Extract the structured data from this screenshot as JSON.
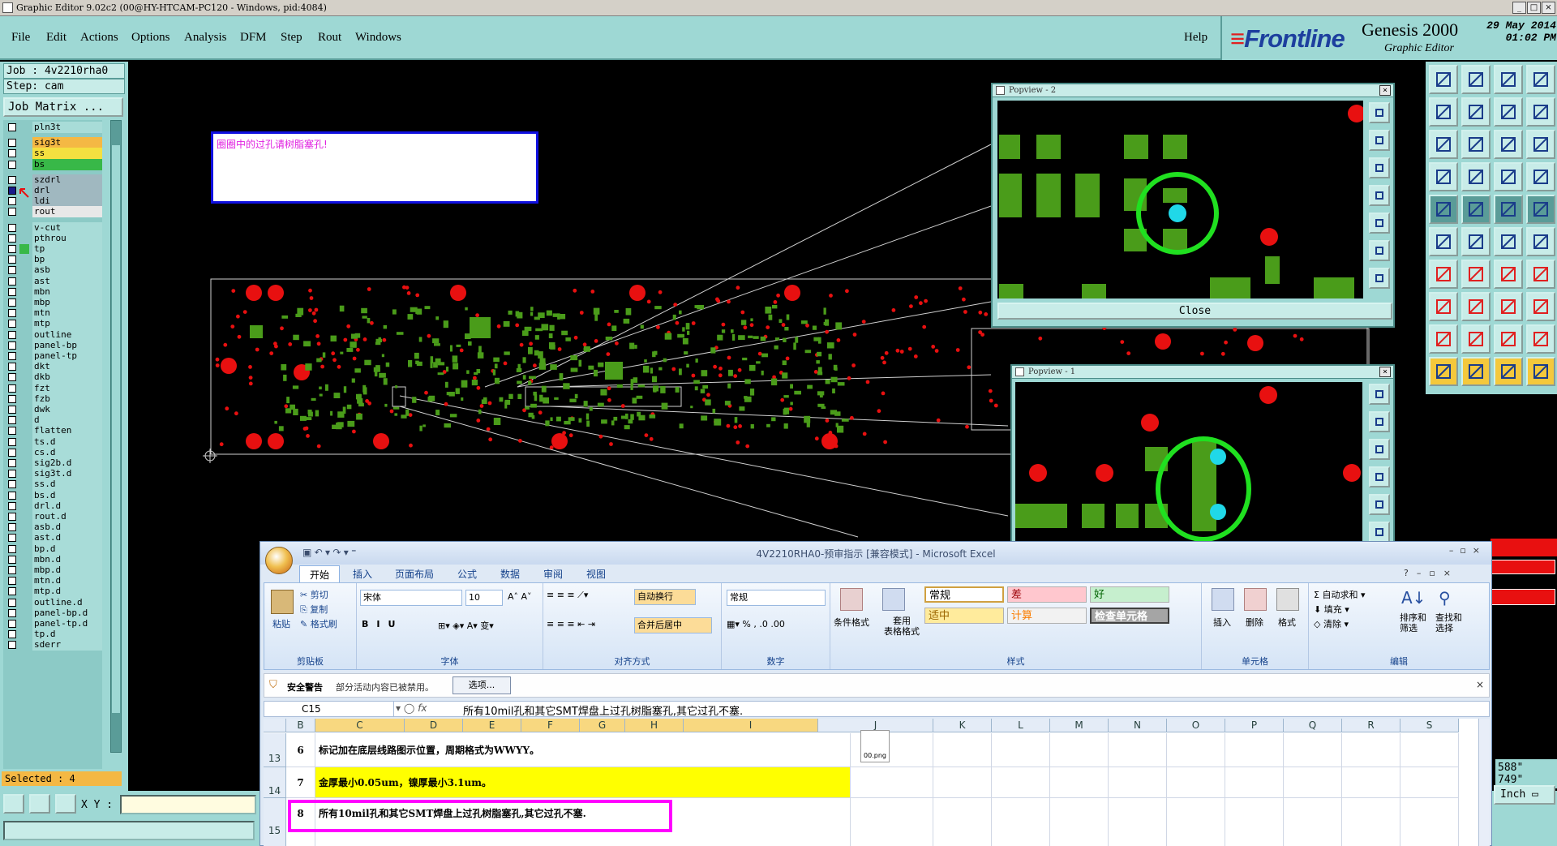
{
  "window": {
    "title": "Graphic Editor 9.02c2 (00@HY-HTCAM-PC120 - Windows, pid:4084)"
  },
  "menu": {
    "items": [
      "File",
      "Edit",
      "Actions",
      "Options",
      "Analysis",
      "DFM",
      "Step",
      "Rout",
      "Windows"
    ],
    "help": "Help"
  },
  "brand": {
    "logo": "Frontline",
    "product": "Genesis 2000",
    "subtitle": "Graphic Editor",
    "date": "29 May 2014",
    "time": "01:02 PM"
  },
  "job": {
    "job_label": "Job : 4v2210rha0",
    "step_label": "Step: cam",
    "matrix_button": "Job Matrix ..."
  },
  "layers": [
    {
      "name": "pln3t",
      "color": "default",
      "group": 0
    },
    {
      "name": "sig3t",
      "color": "orange",
      "group": 1
    },
    {
      "name": "ss",
      "color": "yellow",
      "group": 1
    },
    {
      "name": "bs",
      "color": "green",
      "group": 1
    },
    {
      "name": "szdrl",
      "color": "grey",
      "group": 2
    },
    {
      "name": "drl",
      "color": "grey",
      "group": 2,
      "active": true
    },
    {
      "name": "ldi",
      "color": "grey",
      "group": 2
    },
    {
      "name": "rout",
      "color": "white",
      "group": 2
    },
    {
      "name": "v-cut",
      "color": "default",
      "group": 3
    },
    {
      "name": "pthrou",
      "color": "default",
      "group": 3
    },
    {
      "name": "tp",
      "color": "default",
      "group": 3,
      "marked": true
    },
    {
      "name": "bp",
      "color": "default",
      "group": 3
    },
    {
      "name": "asb",
      "color": "default",
      "group": 3
    },
    {
      "name": "ast",
      "color": "default",
      "group": 3
    },
    {
      "name": "mbn",
      "color": "default",
      "group": 3
    },
    {
      "name": "mbp",
      "color": "default",
      "group": 3
    },
    {
      "name": "mtn",
      "color": "default",
      "group": 3
    },
    {
      "name": "mtp",
      "color": "default",
      "group": 3
    },
    {
      "name": "outline",
      "color": "default",
      "group": 3
    },
    {
      "name": "panel-bp",
      "color": "default",
      "group": 3
    },
    {
      "name": "panel-tp",
      "color": "default",
      "group": 3
    },
    {
      "name": "dkt",
      "color": "default",
      "group": 3
    },
    {
      "name": "dkb",
      "color": "default",
      "group": 3
    },
    {
      "name": "fzt",
      "color": "default",
      "group": 3
    },
    {
      "name": "fzb",
      "color": "default",
      "group": 3
    },
    {
      "name": "dwk",
      "color": "default",
      "group": 3
    },
    {
      "name": "d",
      "color": "default",
      "group": 3
    },
    {
      "name": "flatten",
      "color": "default",
      "group": 3
    },
    {
      "name": "ts.d",
      "color": "default",
      "group": 3
    },
    {
      "name": "cs.d",
      "color": "default",
      "group": 3
    },
    {
      "name": "sig2b.d",
      "color": "default",
      "group": 3
    },
    {
      "name": "sig3t.d",
      "color": "default",
      "group": 3
    },
    {
      "name": "ss.d",
      "color": "default",
      "group": 3
    },
    {
      "name": "bs.d",
      "color": "default",
      "group": 3
    },
    {
      "name": "drl.d",
      "color": "default",
      "group": 3
    },
    {
      "name": "rout.d",
      "color": "default",
      "group": 3
    },
    {
      "name": "asb.d",
      "color": "default",
      "group": 3
    },
    {
      "name": "ast.d",
      "color": "default",
      "group": 3
    },
    {
      "name": "bp.d",
      "color": "default",
      "group": 3
    },
    {
      "name": "mbn.d",
      "color": "default",
      "group": 3
    },
    {
      "name": "mbp.d",
      "color": "default",
      "group": 3
    },
    {
      "name": "mtn.d",
      "color": "default",
      "group": 3
    },
    {
      "name": "mtp.d",
      "color": "default",
      "group": 3
    },
    {
      "name": "outline.d",
      "color": "default",
      "group": 3
    },
    {
      "name": "panel-bp.d",
      "color": "default",
      "group": 3
    },
    {
      "name": "panel-tp.d",
      "color": "default",
      "group": 3
    },
    {
      "name": "tp.d",
      "color": "default",
      "group": 3
    },
    {
      "name": "sderr",
      "color": "default",
      "group": 3
    }
  ],
  "selected": "Selected : 4",
  "xy_label": "X Y :",
  "note": {
    "text": "圈圈中的过孔请树脂塞孔!"
  },
  "popview2": {
    "title": "Popview - 2",
    "close": "Close"
  },
  "popview1": {
    "title": "Popview - 1"
  },
  "coords": {
    "x": "588\"",
    "y": "749\"",
    "units": "Inch"
  },
  "excel": {
    "title": "4V2210RHA0-预审指示  [兼容模式] - Microsoft Excel",
    "tabs": [
      "开始",
      "插入",
      "页面布局",
      "公式",
      "数据",
      "审阅",
      "视图"
    ],
    "clipboard": {
      "paste": "粘贴",
      "cut": "剪切",
      "copy": "复制",
      "format_painter": "格式刷",
      "label": "剪贴板"
    },
    "font": {
      "name": "宋体",
      "size": "10",
      "label": "字体"
    },
    "alignment": {
      "wrap": "自动换行",
      "merge": "合并后居中",
      "label": "对齐方式"
    },
    "number": {
      "format": "常规",
      "label": "数字"
    },
    "styles": {
      "conditional": "条件格式",
      "table": "套用\n表格格式",
      "normal": "常规",
      "bad": "差",
      "good": "好",
      "neutral": "适中",
      "calc": "计算",
      "check": "检查单元格",
      "label": "样式"
    },
    "cells": {
      "insert": "插入",
      "delete": "删除",
      "format": "格式",
      "label": "单元格"
    },
    "editing": {
      "autosum": "自动求和",
      "fill": "填充",
      "clear": "清除",
      "sort": "排序和\n筛选",
      "find": "查找和\n选择",
      "label": "编辑"
    },
    "security": {
      "title": "安全警告",
      "message": "部分活动内容已被禁用。",
      "options": "选项..."
    },
    "namebox": "C15",
    "formula": "所有10mil孔和其它SMT焊盘上过孔树脂塞孔,其它过孔不塞.",
    "columns": [
      "B",
      "C",
      "D",
      "E",
      "F",
      "G",
      "H",
      "I",
      "J",
      "K",
      "L",
      "M",
      "N",
      "O",
      "P",
      "Q",
      "R",
      "S"
    ],
    "rows": [
      {
        "num": "13",
        "b": "6",
        "c": "标记加在底层线路图示位置，周期格式为WWYY。"
      },
      {
        "num": "14",
        "b": "7",
        "c": "金厚最小0.05um，镍厚最小3.1um。"
      },
      {
        "num": "15",
        "b": "8",
        "c": "所有10mil孔和其它SMT焊盘上过孔树脂塞孔,其它过孔不塞."
      }
    ],
    "attachment": "00.png"
  },
  "colors": {
    "panel": "#9ed8d4",
    "pad_green": "#4a9c1a",
    "via_red": "#e81010",
    "highlight_ring": "#20e020",
    "via_cyan": "#20d8e8",
    "excel_highlight": "#ff00ff"
  }
}
